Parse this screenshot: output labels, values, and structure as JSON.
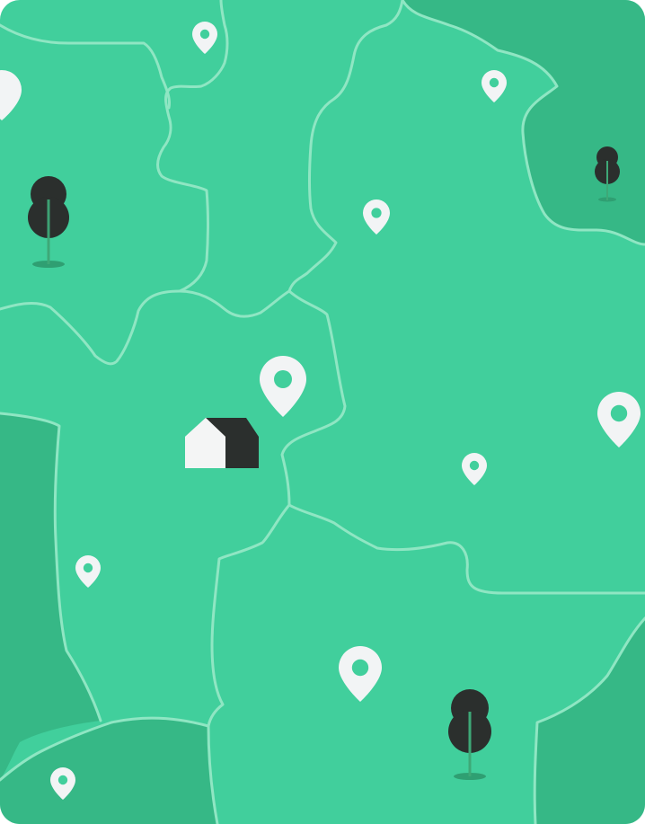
{
  "map": {
    "colors": {
      "background": "#ffffff",
      "land_main": "#41cf9c",
      "land_dark": "#36b886",
      "border_line": "#8fe6c3",
      "pin_fill": "#f2f4f5",
      "pin_hole": "#41cf9c",
      "tree_fill": "#2b2f2d",
      "tree_trunk": "#3ea877",
      "tree_shadow": "#2f9f72",
      "house_light": "#f4f5f5",
      "house_dark": "#2b2f2d"
    },
    "icons": {
      "pin": "map-pin-icon",
      "tree": "tree-icon",
      "house": "house-icon"
    },
    "pins": [
      {
        "id": "pin-1",
        "icon": "map-pin-icon"
      },
      {
        "id": "pin-2",
        "icon": "map-pin-icon"
      },
      {
        "id": "pin-3",
        "icon": "map-pin-icon"
      },
      {
        "id": "pin-4",
        "icon": "map-pin-icon"
      },
      {
        "id": "pin-5",
        "icon": "map-pin-icon"
      },
      {
        "id": "pin-6",
        "icon": "map-pin-icon"
      },
      {
        "id": "pin-7",
        "icon": "map-pin-icon"
      },
      {
        "id": "pin-8",
        "icon": "map-pin-icon"
      },
      {
        "id": "pin-9",
        "icon": "map-pin-icon"
      },
      {
        "id": "pin-10",
        "icon": "map-pin-icon"
      },
      {
        "id": "pin-11",
        "icon": "map-pin-icon"
      }
    ],
    "trees": [
      {
        "id": "tree-1",
        "icon": "tree-icon"
      },
      {
        "id": "tree-2",
        "icon": "tree-icon"
      },
      {
        "id": "tree-3",
        "icon": "tree-icon"
      }
    ],
    "house": {
      "id": "home-marker",
      "icon": "house-icon"
    }
  }
}
